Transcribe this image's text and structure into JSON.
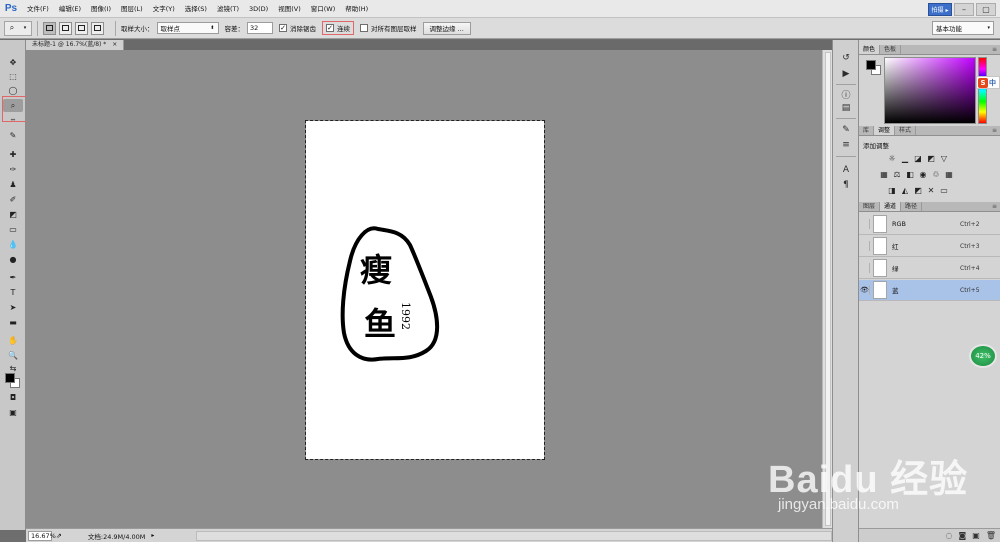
{
  "app": {
    "logo": "Ps",
    "window_button": "拍摄 ▸"
  },
  "menu": [
    "文件(F)",
    "编辑(E)",
    "图像(I)",
    "图层(L)",
    "文字(Y)",
    "选择(S)",
    "滤镜(T)",
    "3D(D)",
    "视图(V)",
    "窗口(W)",
    "帮助(H)"
  ],
  "options": {
    "sample_size_label": "取样大小：",
    "sample_size_value": "取样点",
    "tolerance_label": "容差：",
    "tolerance_value": "32",
    "antialias_label": "消除锯齿",
    "contiguous_label": "连续",
    "all_layers_label": "对所有图层取样",
    "refine_edge_button": "调整边缘 ...",
    "workspace": "基本功能"
  },
  "document": {
    "tab_title": "未标题-1 @ 16.7%(蓝/8) *",
    "artwork_text_1": "瘦",
    "artwork_text_2": "鱼",
    "artwork_year": "1992"
  },
  "status": {
    "zoom": "16.67%",
    "doc_info": "文档:24.9M/4.00M"
  },
  "panels": {
    "color_tabs": [
      "颜色",
      "色板"
    ],
    "adjust_tabs": [
      "库",
      "调整",
      "样式"
    ],
    "adjust_title": "添加调整",
    "channel_tabs": [
      "图层",
      "通道",
      "路径"
    ],
    "channels": [
      {
        "name": "RGB",
        "shortcut": "Ctrl+2",
        "visible": false
      },
      {
        "name": "红",
        "shortcut": "Ctrl+3",
        "visible": false
      },
      {
        "name": "绿",
        "shortcut": "Ctrl+4",
        "visible": false
      },
      {
        "name": "蓝",
        "shortcut": "Ctrl+5",
        "visible": true
      }
    ]
  },
  "ime": {
    "badge": "S",
    "mode": "中"
  },
  "progress_badge": "42%",
  "watermark": {
    "logo": "Baidu 经验",
    "url": "jingyan.baidu.com"
  },
  "colors": {
    "foreground": "#000000",
    "background": "#ffffff",
    "selected_row": "#a9c2e8",
    "highlight_box": "#e06767"
  }
}
